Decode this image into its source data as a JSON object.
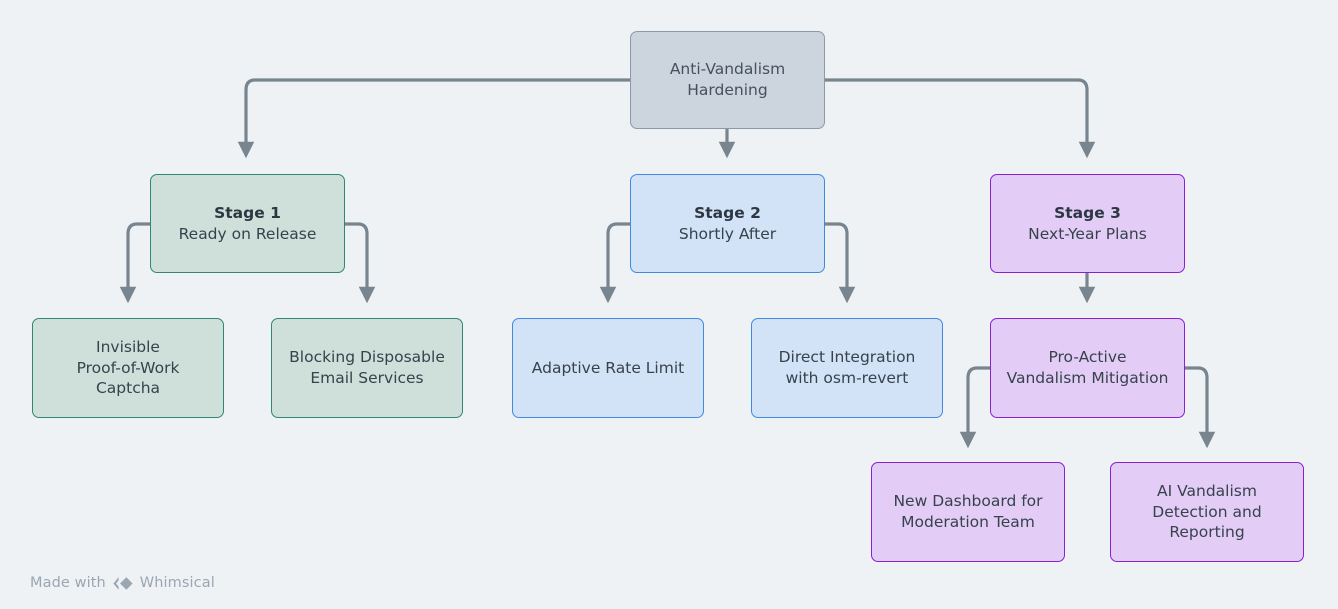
{
  "diagram": {
    "title": "Anti-Vandalism Hardening",
    "background_color": "#eff2f5",
    "edge_color": "#78858f",
    "nodes": {
      "root": {
        "label": "Anti-Vandalism Hardening",
        "line1": "Anti-Vandalism",
        "line2": "Hardening",
        "fill": "#ccd5dd",
        "border": "#8c9aa8"
      },
      "stage1": {
        "title": "Stage 1",
        "subtitle": "Ready on Release",
        "fill": "#cfe0da",
        "border": "#2f8673"
      },
      "stage1_child1": {
        "line1": "Invisible",
        "line2": "Proof-of-Work",
        "line3": "Captcha"
      },
      "stage1_child2": {
        "line1": "Blocking Disposable",
        "line2": "Email Services"
      },
      "stage2": {
        "title": "Stage 2",
        "subtitle": "Shortly After",
        "fill": "#d3e3f7",
        "border": "#3d8ae0"
      },
      "stage2_child1": {
        "line1": "Adaptive Rate Limit"
      },
      "stage2_child2": {
        "line1": "Direct Integration",
        "line2": "with osm-revert"
      },
      "stage3": {
        "title": "Stage 3",
        "subtitle": "Next-Year Plans",
        "fill": "#e3cdf6",
        "border": "#8c1ed4"
      },
      "stage3_child1": {
        "line1": "Pro-Active",
        "line2": "Vandalism Mitigation"
      },
      "stage3_grandchild1": {
        "line1": "New Dashboard for",
        "line2": "Moderation Team"
      },
      "stage3_grandchild2": {
        "line1": "AI Vandalism",
        "line2": "Detection and",
        "line3": "Reporting"
      }
    }
  },
  "watermark": {
    "prefix": "Made with",
    "brand": "Whimsical",
    "logo_icon": "whimsical-diamond-logo"
  }
}
